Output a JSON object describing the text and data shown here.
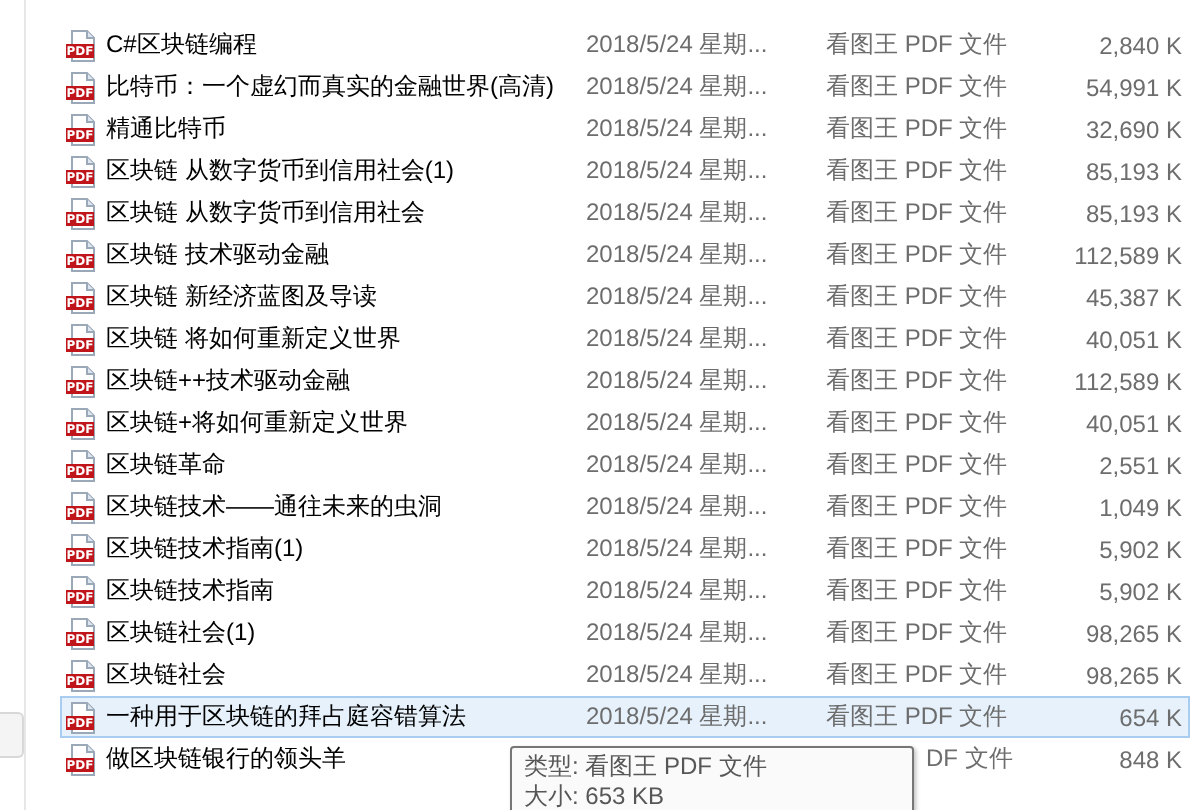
{
  "files": [
    {
      "icon_label": "PDF",
      "name": "C#区块链编程",
      "date": "2018/5/24 星期...",
      "type": "看图王 PDF 文件",
      "size": "2,840 K",
      "selected": false
    },
    {
      "icon_label": "PDF",
      "name": "比特币：一个虚幻而真实的金融世界(高清)",
      "date": "2018/5/24 星期...",
      "type": "看图王 PDF 文件",
      "size": "54,991 K",
      "selected": false
    },
    {
      "icon_label": "PDF",
      "name": "精通比特币",
      "date": "2018/5/24 星期...",
      "type": "看图王 PDF 文件",
      "size": "32,690 K",
      "selected": false
    },
    {
      "icon_label": "PDF",
      "name": "区块链  从数字货币到信用社会(1)",
      "date": "2018/5/24 星期...",
      "type": "看图王 PDF 文件",
      "size": "85,193 K",
      "selected": false
    },
    {
      "icon_label": "PDF",
      "name": "区块链  从数字货币到信用社会",
      "date": "2018/5/24 星期...",
      "type": "看图王 PDF 文件",
      "size": "85,193 K",
      "selected": false
    },
    {
      "icon_label": "PDF",
      "name": "区块链  技术驱动金融",
      "date": "2018/5/24 星期...",
      "type": "看图王 PDF 文件",
      "size": "112,589 K",
      "selected": false
    },
    {
      "icon_label": "PDF",
      "name": "区块链  新经济蓝图及导读",
      "date": "2018/5/24 星期...",
      "type": "看图王 PDF 文件",
      "size": "45,387 K",
      "selected": false
    },
    {
      "icon_label": "PDF",
      "name": "区块链 将如何重新定义世界",
      "date": "2018/5/24 星期...",
      "type": "看图王 PDF 文件",
      "size": "40,051 K",
      "selected": false
    },
    {
      "icon_label": "PDF",
      "name": "区块链++技术驱动金融",
      "date": "2018/5/24 星期...",
      "type": "看图王 PDF 文件",
      "size": "112,589 K",
      "selected": false
    },
    {
      "icon_label": "PDF",
      "name": "区块链+将如何重新定义世界",
      "date": "2018/5/24 星期...",
      "type": "看图王 PDF 文件",
      "size": "40,051 K",
      "selected": false
    },
    {
      "icon_label": "PDF",
      "name": "区块链革命",
      "date": "2018/5/24 星期...",
      "type": "看图王 PDF 文件",
      "size": "2,551 K",
      "selected": false
    },
    {
      "icon_label": "PDF",
      "name": "区块链技术——通往未来的虫洞",
      "date": "2018/5/24 星期...",
      "type": "看图王 PDF 文件",
      "size": "1,049 K",
      "selected": false
    },
    {
      "icon_label": "PDF",
      "name": "区块链技术指南(1)",
      "date": "2018/5/24 星期...",
      "type": "看图王 PDF 文件",
      "size": "5,902 K",
      "selected": false
    },
    {
      "icon_label": "PDF",
      "name": "区块链技术指南",
      "date": "2018/5/24 星期...",
      "type": "看图王 PDF 文件",
      "size": "5,902 K",
      "selected": false
    },
    {
      "icon_label": "PDF",
      "name": "区块链社会(1)",
      "date": "2018/5/24 星期...",
      "type": "看图王 PDF 文件",
      "size": "98,265 K",
      "selected": false
    },
    {
      "icon_label": "PDF",
      "name": "区块链社会",
      "date": "2018/5/24 星期...",
      "type": "看图王 PDF 文件",
      "size": "98,265 K",
      "selected": false
    },
    {
      "icon_label": "PDF",
      "name": "一种用于区块链的拜占庭容错算法",
      "date": "2018/5/24 星期...",
      "type": "看图王 PDF 文件",
      "size": "654 K",
      "selected": true
    },
    {
      "icon_label": "PDF",
      "name": "做区块链银行的领头羊",
      "type": "DF 文件",
      "size": "848 K",
      "selected": false
    }
  ],
  "tooltip": {
    "lines": [
      "类型: 看图王 PDF 文件",
      "大小: 653 KB"
    ]
  }
}
